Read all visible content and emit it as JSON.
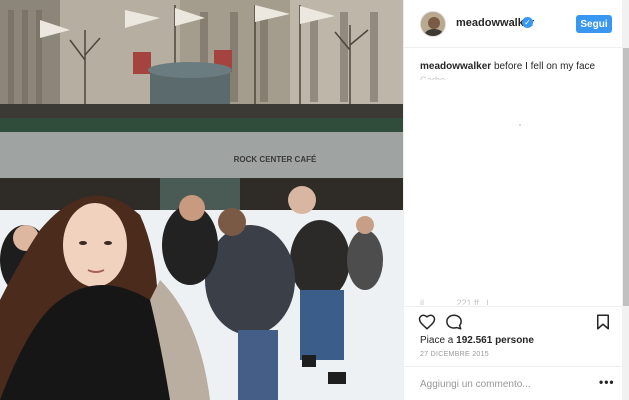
{
  "post": {
    "photo": {
      "icon": "photo-ice-skating-rock-center"
    },
    "sign_text": "ROCK CENTER CAFÉ"
  },
  "header": {
    "username": "meadowwalker",
    "verified_icon": "verified-badge-icon",
    "follow_label": "Segui",
    "accent_color": "#3897f0"
  },
  "caption": {
    "username": "meadowwalker",
    "text": "before I fell on my face"
  },
  "actions": {
    "like_icon": "heart-icon",
    "comment_icon": "comment-bubble-icon",
    "save_icon": "bookmark-icon"
  },
  "likes": {
    "prefix": "Piace a",
    "count": "192.561",
    "suffix": "persone"
  },
  "date": "27 DICEMBRE 2015",
  "comment_box": {
    "placeholder": "Aggiungi un commento...",
    "more_label": "•••"
  }
}
